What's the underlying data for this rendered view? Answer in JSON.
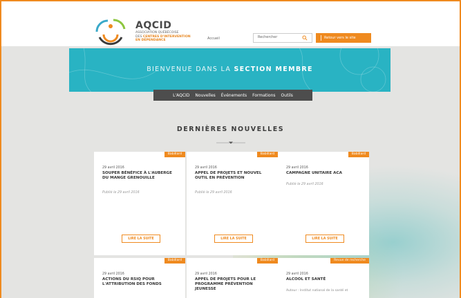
{
  "header": {
    "brand_name": "AQCID",
    "brand_line1": "ASSOCIATION QUÉBÉCOISE",
    "brand_line2_prefix": "DES",
    "brand_line2_strong": "CENTRES D'INTERVENTION",
    "brand_line3": "EN DÉPENDANCE",
    "nav_home": "Accueil",
    "search_placeholder": "Rechercher",
    "site_button": "Retour vers le site"
  },
  "banner": {
    "title_prefix": "BIENVENUE DANS LA",
    "title_strong": "SECTION MEMBRE"
  },
  "menu": [
    "L'AQCID",
    "Nouvelles",
    "Événements",
    "Formations",
    "Outils"
  ],
  "news": {
    "section_title": "DERNIÈRES NOUVELLES",
    "read_more": "LIRE LA SUITE",
    "cards": [
      {
        "badge": "Babillard",
        "date": "29 avril 2016",
        "title": "SOUPER BÉNÉFICE À L'AUBERGE DU MANGE GRENOUILLE",
        "published": "Publié le 29 avril 2016"
      },
      {
        "badge": "Babillard",
        "date": "29 avril 2016",
        "title": "APPEL DE PROJETS ET NOUVEL OUTIL EN PRÉVENTION",
        "published": "Publié le 29 avril 2016"
      },
      {
        "badge": "Babillard",
        "date": "29 avril 2016",
        "title": "CAMPAGNE UNITAIRE ACA",
        "published": "Publié le 29 avril 2016"
      },
      {
        "badge": "Babillard",
        "date": "29 avril 2016",
        "title": "ACTIONS DU RSIQ POUR L'ATTRIBUTION DES FONDS"
      },
      {
        "badge": "Babillard",
        "date": "29 avril 2016",
        "title": "APPEL DE PROJETS POUR LE PROGRAMME PRÉVENTION JEUNESSE"
      },
      {
        "badge": "Revue de recherche",
        "date": "29 avril 2016",
        "title": "ALCOOL ET SANTÉ",
        "author": "Auteur : Institut national de la santé et"
      }
    ]
  },
  "colors": {
    "accent": "#ef8a1f",
    "banner": "#29b3c3",
    "menu": "#4d4d4d"
  }
}
